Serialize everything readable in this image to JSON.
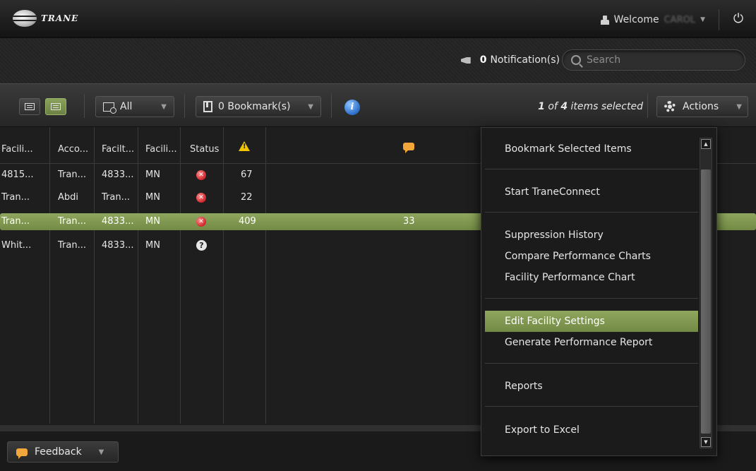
{
  "header": {
    "brand": "TRANE",
    "welcome_label": "Welcome",
    "username": "CAROL"
  },
  "subbar": {
    "notification_count": "0",
    "notification_label": "Notification(s)",
    "search_placeholder": "Search"
  },
  "toolbar": {
    "filter_label": "All",
    "bookmark_label": "0 Bookmark(s)",
    "selected_count": "1",
    "selected_of": "of",
    "selected_total": "4",
    "selected_suffix": "items selected",
    "actions_label": "Actions"
  },
  "table": {
    "columns": [
      "Facili...",
      "Acco...",
      "Facilt...",
      "Facili...",
      "Status"
    ],
    "rows": [
      {
        "c1": "4815...",
        "c2": "Tran...",
        "c3": "4833...",
        "c4": "MN",
        "status": "error",
        "alarms": "67",
        "comments": ""
      },
      {
        "c1": "Tran...",
        "c2": "Abdi",
        "c3": "Tran...",
        "c4": "MN",
        "status": "error",
        "alarms": "22",
        "comments": ""
      },
      {
        "c1": "Tran...",
        "c2": "Tran...",
        "c3": "4833...",
        "c4": "MN",
        "status": "error",
        "alarms": "409",
        "comments": "33"
      },
      {
        "c1": "Whit...",
        "c2": "Tran...",
        "c3": "4833...",
        "c4": "MN",
        "status": "unknown",
        "alarms": "",
        "comments": ""
      }
    ]
  },
  "actions_menu": {
    "items": [
      "Bookmark Selected Items",
      "Start TraneConnect",
      "Suppression History",
      "Compare Performance Charts",
      "Facility Performance Chart",
      "Edit Facility Settings",
      "Generate Performance Report",
      "Reports",
      "Export to Excel"
    ]
  },
  "footer": {
    "feedback_label": "Feedback"
  },
  "colors": {
    "accent_green": "#7f9750",
    "alarm_yellow": "#f2c400",
    "comment_orange": "#f1a73a",
    "status_red": "#d0262b"
  }
}
